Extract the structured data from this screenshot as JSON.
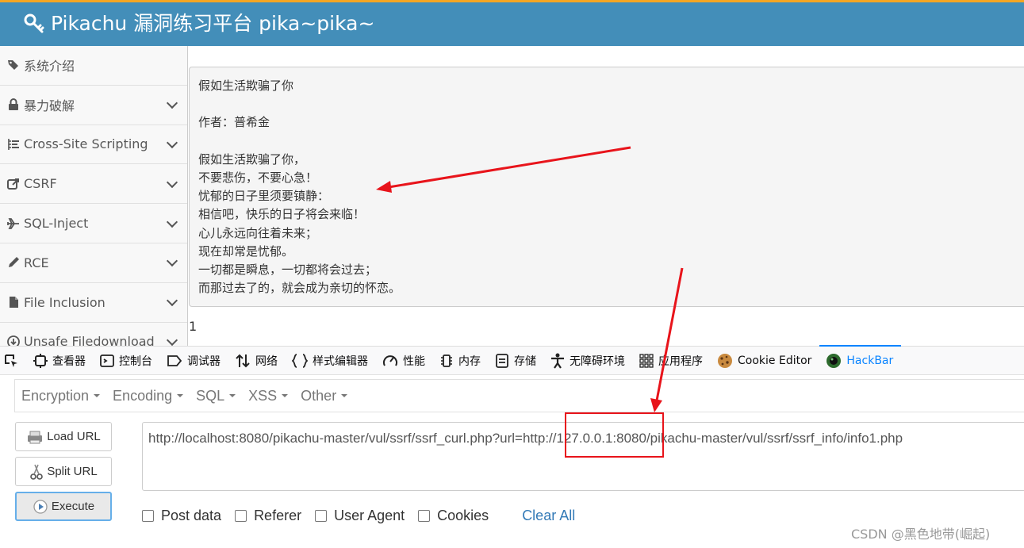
{
  "header": {
    "title": "Pikachu 漏洞练习平台 pika~pika~",
    "icon": "key-icon",
    "brand_color": "#438eb9"
  },
  "sidebar": {
    "items": [
      {
        "label": "系统介绍",
        "icon": "tags-icon",
        "has_chevron": false
      },
      {
        "label": "暴力破解",
        "icon": "lock-icon",
        "has_chevron": true
      },
      {
        "label": "Cross-Site Scripting",
        "icon": "list-icon",
        "has_chevron": true
      },
      {
        "label": "CSRF",
        "icon": "share-icon",
        "has_chevron": true
      },
      {
        "label": "SQL-Inject",
        "icon": "plane-icon",
        "has_chevron": true
      },
      {
        "label": "RCE",
        "icon": "pencil-icon",
        "has_chevron": true
      },
      {
        "label": "File Inclusion",
        "icon": "file-icon",
        "has_chevron": true
      },
      {
        "label": "Unsafe Filedownload",
        "icon": "download-icon",
        "has_chevron": true
      }
    ]
  },
  "content": {
    "lines": [
      "假如生活欺骗了你",
      "",
      "作者：普希金",
      "",
      "假如生活欺骗了你，",
      "不要悲伤，不要心急！",
      "忧郁的日子里须要镇静：",
      "相信吧，快乐的日子将会来临！",
      "心儿永远向往着未来；",
      "现在却常是忧郁。",
      "一切都是瞬息，一切都将会过去；",
      "而那过去了的，就会成为亲切的怀恋。"
    ],
    "after_text": "1"
  },
  "devtools": {
    "tabs": [
      {
        "label": "查看器",
        "icon": "inspector-icon"
      },
      {
        "label": "控制台",
        "icon": "console-icon"
      },
      {
        "label": "调试器",
        "icon": "debugger-icon"
      },
      {
        "label": "网络",
        "icon": "network-icon"
      },
      {
        "label": "样式编辑器",
        "icon": "style-editor-icon"
      },
      {
        "label": "性能",
        "icon": "performance-icon"
      },
      {
        "label": "内存",
        "icon": "memory-icon"
      },
      {
        "label": "存储",
        "icon": "storage-icon"
      },
      {
        "label": "无障碍环境",
        "icon": "accessibility-icon"
      },
      {
        "label": "应用程序",
        "icon": "application-icon"
      },
      {
        "label": "Cookie Editor",
        "icon": "cookie-icon"
      },
      {
        "label": "HackBar",
        "icon": "hackbar-icon",
        "active": true
      }
    ]
  },
  "hackbar": {
    "menu": [
      "Encryption",
      "Encoding",
      "SQL",
      "XSS",
      "Other"
    ],
    "buttons": {
      "load": "Load URL",
      "split": "Split URL",
      "execute": "Execute"
    },
    "url": "http://localhost:8080/pikachu-master/vul/ssrf/ssrf_curl.php?url=http://127.0.0.1:8080/pikachu-master/vul/ssrf/ssrf_info/info1.php",
    "options": [
      {
        "label": "Post data",
        "checked": false
      },
      {
        "label": "Referer",
        "checked": false
      },
      {
        "label": "User Agent",
        "checked": false
      },
      {
        "label": "Cookies",
        "checked": false
      }
    ],
    "clear_all": "Clear All"
  },
  "watermark": "CSDN @黑色地带(崛起)",
  "colors": {
    "annotation_red": "#e8141b",
    "active_tab": "#0a84ff"
  }
}
